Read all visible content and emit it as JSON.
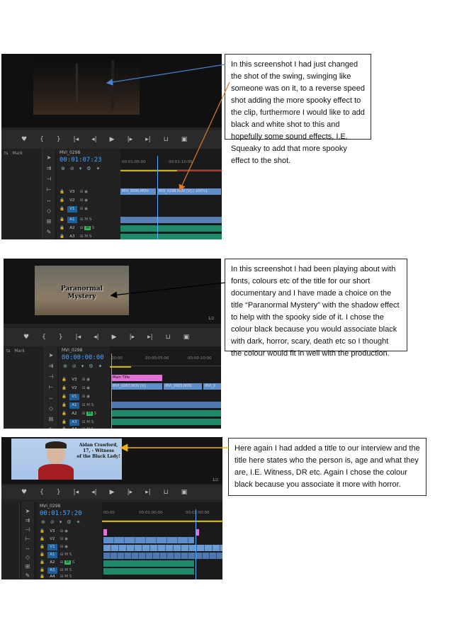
{
  "notes": [
    {
      "text": "In this screenshot I had just changed the shot of the swing, swinging like someone was on it, to a reverse speed shot adding the more spooky effect to the clip, furthermore I would like to add black and white shot to this and hopefully some sound effects, I.E. Squeaky to add that more spooky effect to the shot."
    },
    {
      "text": "In this screenshot I had been playing about with fonts, colours etc of the title for our short documentary and I have made a choice on the title “Paranormal Mystery” with the shadow effect to help with the spooky side of it. I chose the colour black because you would associate black with dark, horror, scary, death etc so I thought the colour would fit in well with the production."
    },
    {
      "text": "Here again I had added a title to our interview and the title here states who the person is, age and what they are, I.E. Witness, DR etc. Again I chose the colour black because you associate it more with horror."
    }
  ],
  "screenshots": [
    {
      "panel_tabs": [
        "ts",
        "Mark"
      ],
      "sequence": "MVI_0298",
      "timecode": "00:01:07:23",
      "ruler": [
        "00:01:05:00",
        "00:01:10:00"
      ],
      "tracks": [
        "V3",
        "V2",
        "V1",
        "A1",
        "A2",
        "A3"
      ],
      "clips": [
        "MVI_0095.MOV",
        "MVI_0298.MOV [V] [-100%]"
      ]
    },
    {
      "panel_tabs": [
        "ts",
        "Mark"
      ],
      "sequence": "MVI_0298",
      "timecode": "00:00:00:00",
      "ruler": [
        "00:00",
        "00:00:05:00",
        "00:00:10:00"
      ],
      "tracks": [
        "V3",
        "V2",
        "V1",
        "A1",
        "A2",
        "A3",
        "A4"
      ],
      "clips": [
        "Main Title",
        "MVI_0083.MOV [V]",
        "MVI_0083.MOV",
        "MVI_0"
      ],
      "title_text": [
        "Paranormal",
        "Mystery"
      ],
      "frame_label": "1/2"
    },
    {
      "sequence": "MVI_0298",
      "timecode": "00:01:57:20",
      "ruler": [
        "00:00",
        "00:01:00:00",
        "00:02:00:00"
      ],
      "tracks": [
        "V3",
        "V2",
        "V1",
        "A1",
        "A2",
        "A3",
        "A4"
      ],
      "lower_third": [
        "Aidan Crawford, 17, - Witness",
        "of the Black Lady!"
      ],
      "frame_label": "1/2"
    }
  ],
  "colors": {
    "arrow_blue": "#4a7fd0",
    "arrow_orange": "#e07b1f",
    "arrow_black": "#000000",
    "arrow_yellow": "#e8b21c",
    "timecode_blue": "#4aa3ff"
  }
}
